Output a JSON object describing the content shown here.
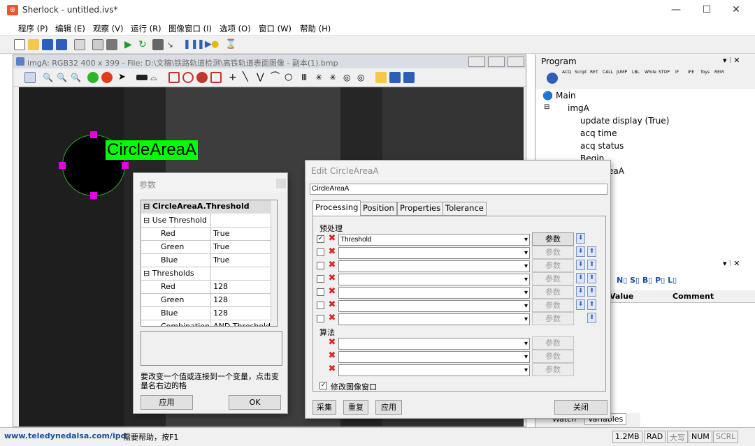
{
  "app": {
    "title": "Sherlock - untitled.ivs*",
    "min": "—",
    "max": "☐",
    "close": "✕"
  },
  "menu": [
    "程序 (P)",
    "编辑 (E)",
    "观察 (V)",
    "运行 (R)",
    "图像窗口 (I)",
    "选项 (O)",
    "窗口 (W)",
    "帮助 (H)"
  ],
  "image_window": {
    "title": "imgA: RGB32 400 x 399 - File: D:\\文稿\\铁路轨道检测\\高铁轨道表面图像 - 副本(1).bmp",
    "roi_label": "CircleAreaA"
  },
  "program": {
    "title": "Program",
    "tool_labels": [
      "ACQ",
      "Script",
      "RET",
      "CALL",
      "JUMP",
      "LBL",
      "While",
      "STOP",
      "IF",
      "IFE",
      "Toys",
      "REM"
    ],
    "tree": [
      "Main",
      "imgA",
      "update display (True)",
      "acq time",
      "acq status",
      "Begin",
      "eaA"
    ]
  },
  "variables": {
    "buttons": "N▯ S▯ B▯ P▯ L▯",
    "columns": [
      "Value",
      "Comment"
    ],
    "tabs": [
      "Watch",
      "Variables"
    ]
  },
  "param_dialog": {
    "title": "参数",
    "header": "CircleAreaA.Threshold",
    "rows": [
      {
        "name": "Use Threshold",
        "value": "",
        "group": true
      },
      {
        "name": "Red",
        "value": "True"
      },
      {
        "name": "Green",
        "value": "True"
      },
      {
        "name": "Blue",
        "value": "True"
      },
      {
        "name": "Thresholds",
        "value": "",
        "group": true
      },
      {
        "name": "Red",
        "value": "128"
      },
      {
        "name": "Green",
        "value": "128"
      },
      {
        "name": "Blue",
        "value": "128"
      },
      {
        "name": "Combination",
        "value": "AND Threshold"
      }
    ],
    "help": "要改变一个值或连接到一个变量，点击变量名右边的格",
    "apply": "应用",
    "ok": "OK"
  },
  "edit_dialog": {
    "title": "Edit CircleAreaA",
    "name": "CircleAreaA",
    "tabs": [
      "Processing",
      "Position",
      "Properties",
      "Tolerance"
    ],
    "preprocess_label": "预处理",
    "preprocess_first": "Threshold",
    "param_btn": "参数",
    "algo_label": "算法",
    "modify_label": "修改图像窗口",
    "acquire": "采集",
    "reset": "重复",
    "apply": "应用",
    "close": "关闭"
  },
  "status": {
    "url": "www.teledynedalsa.com/ipd",
    "help": "需要帮助，按F1",
    "mem": "1.2MB",
    "rad": "RAD",
    "caps": "大写",
    "num": "NUM",
    "scrl": "SCRL"
  }
}
